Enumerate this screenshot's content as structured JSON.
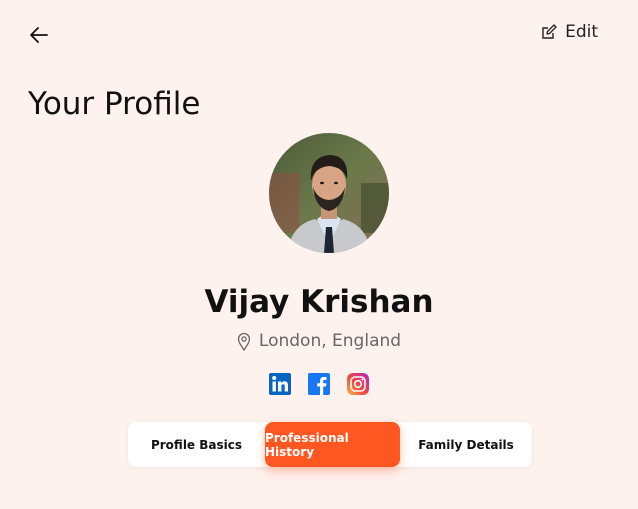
{
  "header": {
    "back_icon": "arrow-left-icon",
    "edit_icon": "edit-icon",
    "edit_label": "Edit"
  },
  "page": {
    "title": "Your Profile"
  },
  "profile": {
    "name": "Vijay Krishan",
    "location_icon": "location-pin-icon",
    "location": "London, England",
    "socials": [
      "linkedin-icon",
      "facebook-icon",
      "instagram-icon"
    ]
  },
  "tabs": {
    "items": [
      {
        "label": "Profile Basics"
      },
      {
        "label": "Professional History"
      },
      {
        "label": "Family Details"
      }
    ],
    "active_index": 1
  },
  "colors": {
    "background": "#fdf2ee",
    "accent": "#ff5722",
    "linkedin": "#0a66c2",
    "facebook": "#1877f2"
  }
}
